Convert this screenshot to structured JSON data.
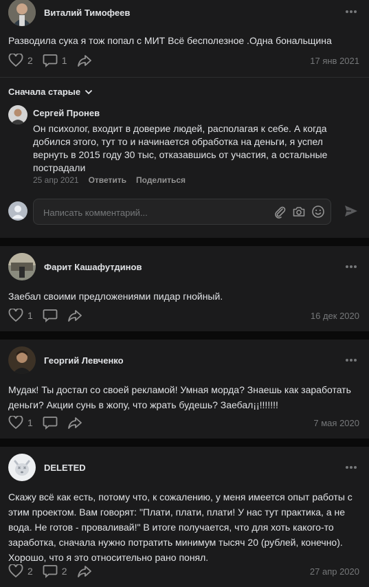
{
  "posts": [
    {
      "author": "Виталий Тимофеев",
      "text": "Разводила сука я тож попал с МИТ Всё бесполезное .Одна бональщина",
      "likes": "2",
      "comments": "1",
      "date": "17 янв 2021"
    },
    {
      "author": "Фарит Кашафутдинов",
      "text": "Заебал своими предложениями пидар гнойный.",
      "likes": "1",
      "comments": "",
      "date": "16 дек 2020"
    },
    {
      "author": "Георгий Левченко",
      "text": "Мудак! Ты достал со своей рекламой! Умная морда? Знаешь как заработать деньги? Акции сунь в жопу, что жрать будешь? Заебал¡¡!!!!!!!",
      "likes": "1",
      "comments": "",
      "date": "7 мая 2020"
    },
    {
      "author": "DELETED",
      "text": "Скажу всё как есть, потому что, к сожалению, у меня имеется опыт работы с этим проектом. Вам говорят: \"Плати, плати, плати! У нас тут практика, а не вода. Не готов - проваливай!\" В итоге получается, что для хоть какого-то заработка, сначала нужно потратить минимум тысяч 20 (рублей, конечно). Хорошо, что я это относительно рано понял.",
      "likes": "2",
      "comments": "2",
      "date": "27 апр 2020"
    }
  ],
  "comments_section": {
    "sort_label": "Сначала старые",
    "comment": {
      "author": "Сергей Пронев",
      "text": "Он психолог, входит в доверие людей, располагая к себе. А когда добился этого, тут то и начинается обработка на деньги, я успел вернуть в 2015 году 30 тыс, отказавшись от участия, а остальные пострадали",
      "date": "25 апр 2021",
      "reply_label": "Ответить",
      "share_label": "Поделиться"
    },
    "input_placeholder": "Написать комментарий..."
  },
  "colors": {
    "background": "#1b1b1c",
    "text": "#e1e3e6",
    "secondary": "#76787a",
    "icon": "#939393"
  }
}
